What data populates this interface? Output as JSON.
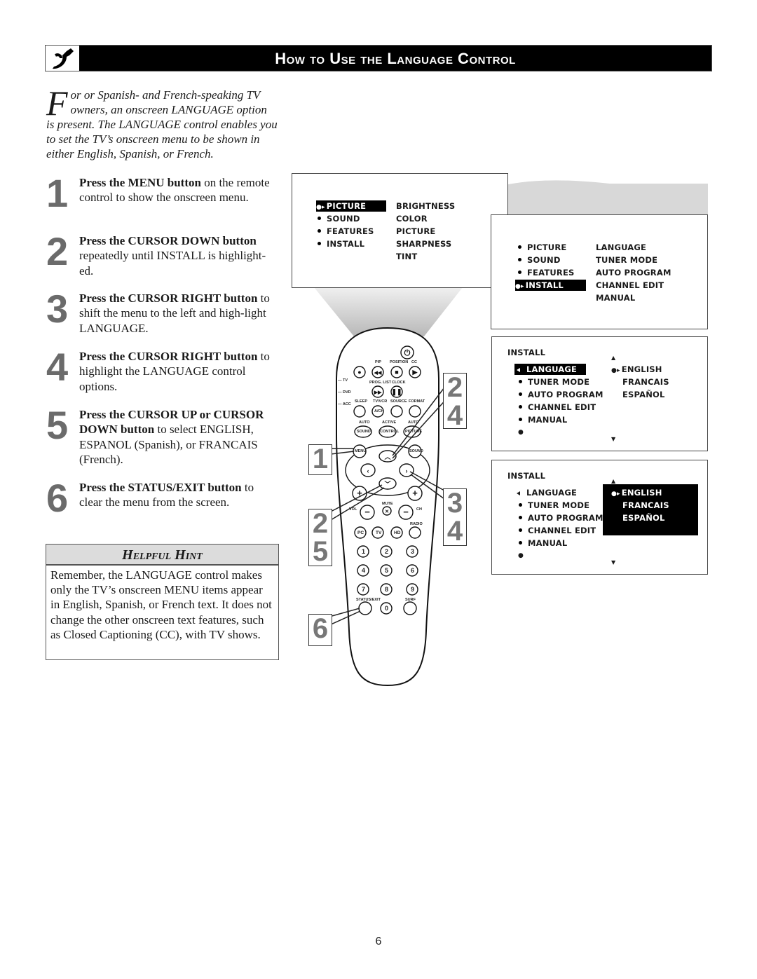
{
  "header": {
    "title": "How to Use the Language Control",
    "icon": "wrench-icon"
  },
  "intro": {
    "dropcap": "F",
    "text": "or or Spanish- and French-speaking TV owners, an onscreen LANGUAGE option is present.  The LANGUAGE control enables you to set the TV’s onscreen menu to be shown in either English, Spanish, or French."
  },
  "steps": [
    {
      "num": "1",
      "bold": "Press the MENU button",
      "rest": " on the remote control to show the onscreen menu."
    },
    {
      "num": "2",
      "bold": "Press the CURSOR DOWN button",
      "rest": " repeatedly until INSTALL is highlight-ed."
    },
    {
      "num": "3",
      "bold": "Press the CURSOR RIGHT button",
      "rest": " to shift the menu to the left and high-light LANGUAGE."
    },
    {
      "num": "4",
      "bold": "Press the CURSOR RIGHT button",
      "rest": " to highlight the LANGUAGE control options."
    },
    {
      "num": "5",
      "bold": "Press the CURSOR UP or CURSOR DOWN button",
      "rest": " to select ENGLISH, ESPANOL (Spanish), or FRANCAIS (French)."
    },
    {
      "num": "6",
      "bold": "Press the STATUS/EXIT button",
      "rest": " to clear the menu from the screen."
    }
  ],
  "hint": {
    "title": "Helpful Hint",
    "body": "Remember, the LANGUAGE control makes only the TV’s onscreen MENU items appear in English, Spanish, or French text.  It does not change the other onscreen text features, such as Closed Captioning (CC), with TV shows."
  },
  "screens": {
    "main_menu": {
      "left": [
        "PICTURE",
        "SOUND",
        "FEATURES",
        "INSTALL"
      ],
      "right": [
        "BRIGHTNESS",
        "COLOR",
        "PICTURE",
        "SHARPNESS",
        "TINT"
      ],
      "highlighted": "PICTURE"
    },
    "install_menu": {
      "left": [
        "PICTURE",
        "SOUND",
        "FEATURES",
        "INSTALL"
      ],
      "right": [
        "LANGUAGE",
        "TUNER MODE",
        "AUTO PROGRAM",
        "CHANNEL EDIT",
        "MANUAL"
      ],
      "highlighted": "INSTALL"
    },
    "language_menu": {
      "title": "INSTALL",
      "left": [
        "LANGUAGE",
        "TUNER MODE",
        "AUTO PROGRAM",
        "CHANNEL EDIT",
        "MANUAL"
      ],
      "right": [
        "ENGLISH",
        "FRANCAIS",
        "ESPAÑOL"
      ],
      "highlighted": "LANGUAGE"
    },
    "language_options": {
      "title": "INSTALL",
      "left": [
        "LANGUAGE",
        "TUNER MODE",
        "AUTO PROGRAM",
        "CHANNEL EDIT",
        "MANUAL"
      ],
      "right": [
        "ENGLISH",
        "FRANCAIS",
        "ESPAÑOL"
      ],
      "highlighted": "ENGLISH"
    }
  },
  "remote": {
    "labels": {
      "pip": "PIP",
      "position": "POSITION",
      "cc": "CC",
      "tv": "— TV",
      "dvd": "— DVD",
      "acc": "— ACC",
      "prog_list": "PROG. LIST",
      "clock": "CLOCK",
      "sleep": "SLEEP",
      "tvvcr": "TV/VCR",
      "source": "SOURCE",
      "format": "FORMAT",
      "ach": "A/CH",
      "auto1": "AUTO",
      "active": "ACTIVE",
      "auto2": "AUTO",
      "sound": "SOUND",
      "control": "CONTROL",
      "picture": "PICTURE",
      "menu": "MENU",
      "sound2": "SOUND",
      "vol": "VOL",
      "ch": "CH",
      "mute": "MUTE",
      "radio": "RADIO",
      "pc": "PC",
      "tv_btn": "TV",
      "hd": "HD",
      "status_exit": "STATUS/EXIT",
      "surf": "SURF"
    },
    "digits": [
      "1",
      "2",
      "3",
      "4",
      "5",
      "6",
      "7",
      "8",
      "9",
      "0"
    ]
  },
  "callouts": {
    "c1": [
      "1"
    ],
    "c24": [
      "2",
      "4"
    ],
    "c25": [
      "2",
      "5"
    ],
    "c34": [
      "3",
      "4"
    ],
    "c6": [
      "6"
    ]
  },
  "page_number": "6"
}
